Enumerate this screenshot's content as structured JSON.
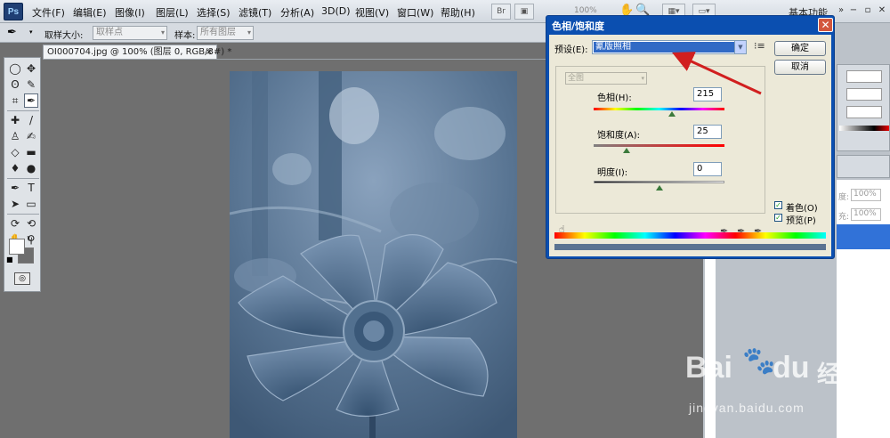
{
  "menubar": {
    "logo": "Ps",
    "items": [
      "文件(F)",
      "编辑(E)",
      "图像(I)",
      "图层(L)",
      "选择(S)",
      "滤镜(T)",
      "分析(A)",
      "3D(D)",
      "视图(V)",
      "窗口(W)",
      "帮助(H)"
    ],
    "zoom": "100%",
    "workspace": "基本功能"
  },
  "options": {
    "sample_size_label": "取样大小:",
    "sample_size_value": "取样点",
    "sample_label": "样本:",
    "sample_value": "所有图层"
  },
  "document": {
    "tab_title": "OI000704.jpg @ 100% (图层 0, RGB/8#) *",
    "tab_close": "×"
  },
  "right_panels": {
    "values": [
      "100%",
      "100%"
    ],
    "labels": [
      "度:",
      "充:"
    ]
  },
  "dialog": {
    "title": "色相/饱和度",
    "preset_label": "预设(E):",
    "preset_value": "氰版照相",
    "ok": "确定",
    "cancel": "取消",
    "edit_channel": "全图",
    "hue_label": "色相(H):",
    "hue_value": "215",
    "saturation_label": "饱和度(A):",
    "saturation_value": "25",
    "lightness_label": "明度(I):",
    "lightness_value": "0",
    "colorize_label": "着色(O)",
    "colorize_checked": true,
    "preview_label": "预览(P)",
    "preview_checked": true,
    "hue_pos": 0.6,
    "sat_pos": 0.25,
    "light_pos": 0.5
  },
  "watermark": {
    "brand": "Bai",
    "brand2": "du",
    "cn": "经验",
    "url": "jingyan.baidu.com"
  }
}
